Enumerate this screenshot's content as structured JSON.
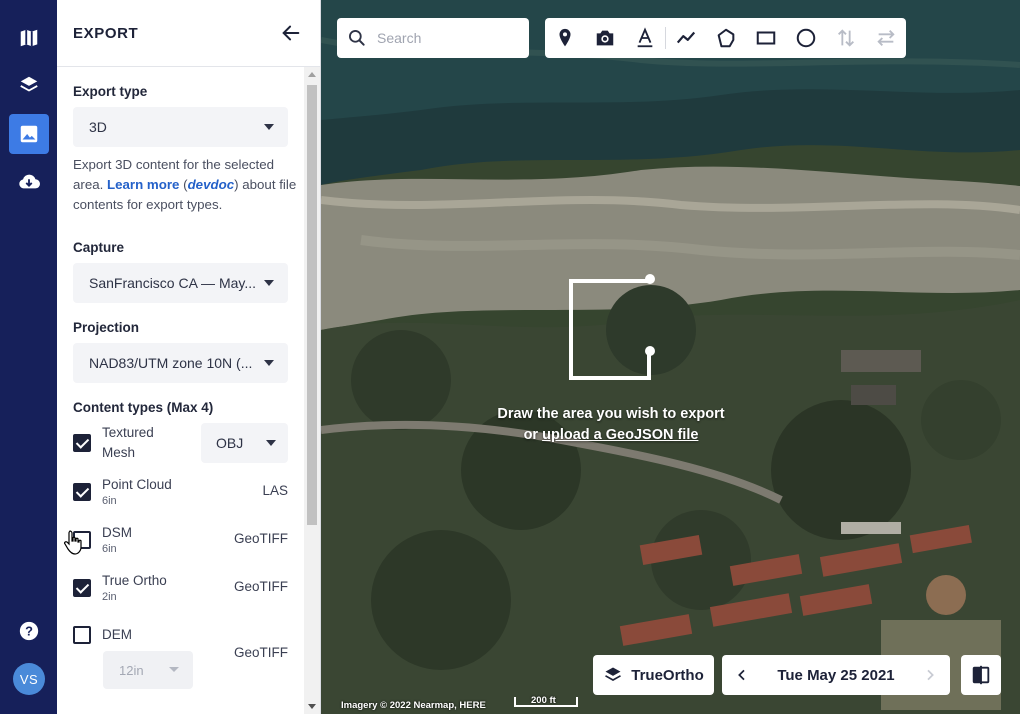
{
  "rail": {
    "items": [
      {
        "icon": "map-icon"
      },
      {
        "icon": "layers-icon"
      },
      {
        "icon": "image-export-icon",
        "active": true
      },
      {
        "icon": "cloud-download-icon"
      }
    ],
    "help_icon": "help-icon",
    "avatar_initials": "VS"
  },
  "panel": {
    "title": "EXPORT",
    "export_type": {
      "label": "Export type",
      "value": "3D",
      "desc_prefix": "Export 3D content for the selected area. ",
      "learn_more": "Learn more",
      "paren_open": " (",
      "devdoc": "devdoc",
      "desc_suffix": ") about file contents for export types."
    },
    "capture": {
      "label": "Capture",
      "value": "SanFrancisco CA — May..."
    },
    "projection": {
      "label": "Projection",
      "value": "NAD83/UTM zone 10N (..."
    },
    "content_types": {
      "label": "Content types (Max 4)",
      "items": [
        {
          "name": "Textured Mesh",
          "sub": "",
          "format": "OBJ",
          "checked": true
        },
        {
          "name": "Point Cloud",
          "sub": "6in",
          "format": "LAS",
          "checked": true
        },
        {
          "name": "DSM",
          "sub": "6in",
          "format": "GeoTIFF",
          "checked": false
        },
        {
          "name": "True Ortho",
          "sub": "2in",
          "format": "GeoTIFF",
          "checked": true
        },
        {
          "name": "DEM",
          "sub": "",
          "format": "GeoTIFF",
          "checked": false,
          "resolution": "12in"
        }
      ]
    }
  },
  "map": {
    "search_placeholder": "Search",
    "tools": [
      "pin-icon",
      "camera-icon",
      "text-icon",
      "polyline-icon",
      "polygon-icon",
      "rectangle-icon",
      "circle-icon",
      "vertical-arrows-icon",
      "horizontal-arrows-icon"
    ],
    "draw_msg_line1": "Draw the area you wish to export",
    "draw_msg_or": "or ",
    "draw_msg_link": "upload a GeoJSON file",
    "layer_button": "TrueOrtho",
    "date": "Tue May 25 2021",
    "attribution": "Imagery © 2022 Nearmap, HERE",
    "scale_label": "200 ft"
  },
  "colors": {
    "rail_bg": "#16205a",
    "accent": "#3d7be5",
    "link": "#2461c9"
  }
}
